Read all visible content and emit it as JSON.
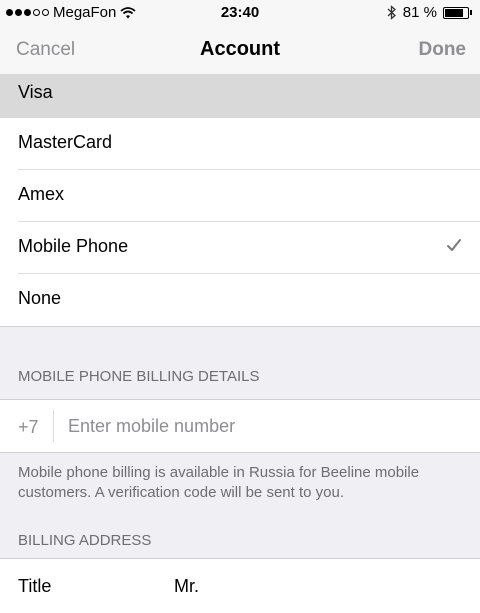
{
  "status_bar": {
    "carrier": "MegaFon",
    "time": "23:40",
    "battery": "81 %",
    "battery_level": 0.81
  },
  "nav": {
    "cancel": "Cancel",
    "title": "Account",
    "done": "Done"
  },
  "payment_options": [
    {
      "label": "Visa",
      "highlighted": true,
      "checked": false
    },
    {
      "label": "MasterCard",
      "highlighted": false,
      "checked": false
    },
    {
      "label": "Amex",
      "highlighted": false,
      "checked": false
    },
    {
      "label": "Mobile Phone",
      "highlighted": false,
      "checked": true
    },
    {
      "label": "None",
      "highlighted": false,
      "checked": false
    }
  ],
  "mobile_billing": {
    "header": "MOBILE PHONE BILLING DETAILS",
    "prefix": "+7",
    "placeholder": "Enter mobile number",
    "note": "Mobile phone billing is available in Russia for Beeline mobile customers. A verification code will be sent to you."
  },
  "billing_address": {
    "header": "BILLING ADDRESS",
    "title_label": "Title",
    "title_value": "Mr."
  },
  "icons": [
    "signal-icon",
    "wifi-icon",
    "bluetooth-icon",
    "battery-icon",
    "checkmark-icon"
  ],
  "colors": {
    "background": "#efeff4",
    "bar": "#f7f7f7",
    "highlight": "#d9d9d9",
    "secondary_text": "#8e8e93"
  }
}
